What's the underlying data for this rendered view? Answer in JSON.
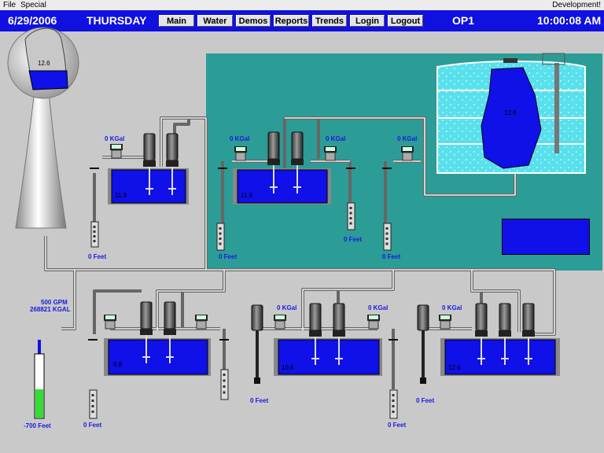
{
  "menu": {
    "file": "File",
    "special": "Special",
    "right": "Development!"
  },
  "header": {
    "date": "6/29/2006",
    "day": "THURSDAY",
    "operator": "OP1",
    "time": "10:00:08 AM",
    "nav": [
      "Main",
      "Water",
      "Demos",
      "Reports",
      "Trends",
      "Login",
      "Logout"
    ]
  },
  "tower": {
    "level": "12.6"
  },
  "well": {
    "flow": "500 GPM",
    "total": "268821 KGAL",
    "depth": "-700 Feet",
    "level_fraction": 0.45
  },
  "upper_left": {
    "meter": "0 KGal",
    "tank": "11.9",
    "feet": "0 Feet"
  },
  "teal": {
    "meter_left": "0 KGal",
    "meter_right": "0 KGal",
    "meter_far": "0 KGal",
    "tank": "11.9",
    "storage": "12.6",
    "feet_left": "0 Feet",
    "feet_mid": "0 Feet",
    "feet_right": "0 Feet"
  },
  "lower1": {
    "tank": "9.8",
    "feet": "0 Feet"
  },
  "lower2": {
    "meter_left": "0 KGal",
    "meter_right": "0 KGal",
    "tank": "10.6",
    "feet_left": "0 Feet",
    "feet_right": "0 Feet"
  },
  "lower3": {
    "meter": "0 KGal",
    "tank": "12.6",
    "feet": "0 Feet"
  },
  "colors": {
    "header": "#1010e0",
    "water": "#1010e8",
    "teal": "#2c9c96",
    "label": "#1a1ae0",
    "level_fill": "#33dd33"
  }
}
